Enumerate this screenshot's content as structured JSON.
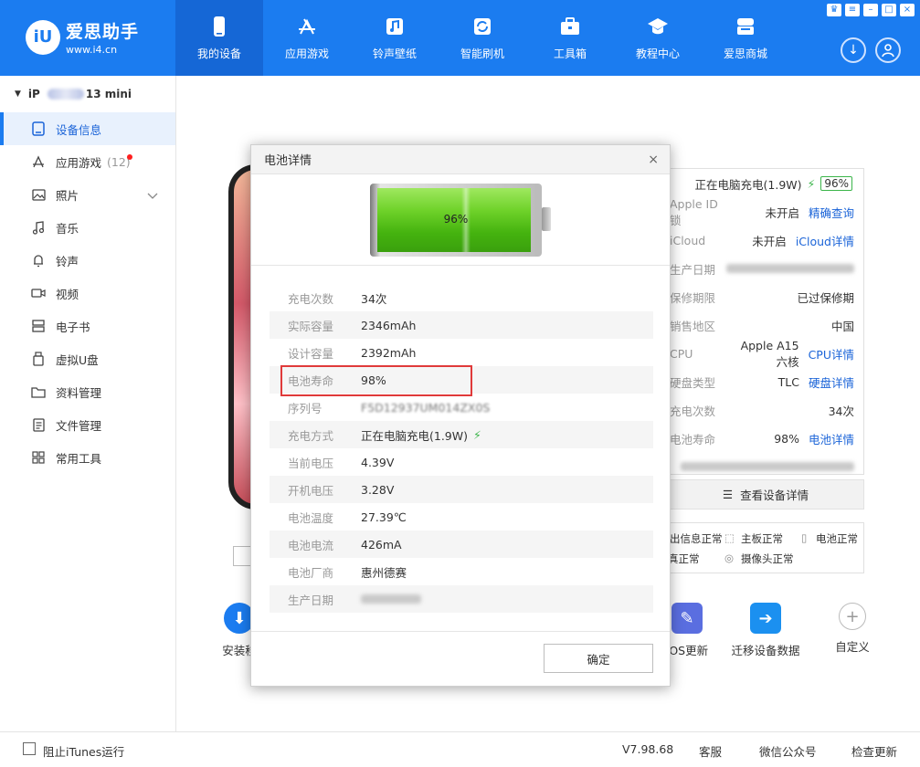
{
  "app": {
    "logo_mark": "iU",
    "title": "爱思助手",
    "url": "www.i4.cn"
  },
  "nav": {
    "items": [
      {
        "label": "我的设备",
        "icon": "phone-icon",
        "active": true
      },
      {
        "label": "应用游戏",
        "icon": "app-store-icon"
      },
      {
        "label": "铃声壁纸",
        "icon": "music-wallpaper-icon"
      },
      {
        "label": "智能刷机",
        "icon": "flash-icon"
      },
      {
        "label": "工具箱",
        "icon": "toolbox-icon"
      },
      {
        "label": "教程中心",
        "icon": "graduation-cap-icon"
      },
      {
        "label": "爱思商城",
        "icon": "store-icon"
      }
    ]
  },
  "sidebar": {
    "device_prefix": "iP",
    "device_suffix": "13 mini",
    "items": [
      {
        "label": "设备信息",
        "icon": "device-info-icon",
        "active": true
      },
      {
        "label": "应用游戏",
        "count": "(12)",
        "icon": "app-icon"
      },
      {
        "label": "照片",
        "icon": "photo-icon"
      },
      {
        "label": "音乐",
        "icon": "music-icon"
      },
      {
        "label": "铃声",
        "icon": "bell-icon"
      },
      {
        "label": "视频",
        "icon": "video-icon"
      },
      {
        "label": "电子书",
        "icon": "ebook-icon"
      },
      {
        "label": "虚拟U盘",
        "icon": "usb-icon"
      },
      {
        "label": "资料管理",
        "icon": "folder-icon"
      },
      {
        "label": "文件管理",
        "icon": "file-icon"
      },
      {
        "label": "常用工具",
        "icon": "tools-grid-icon"
      }
    ]
  },
  "info_panel": {
    "charging_text": "正在电脑充电(1.9W)",
    "battery_percent": "96%",
    "rows": [
      {
        "key": "Apple ID锁",
        "value": "未开启",
        "link": "精确查询"
      },
      {
        "key": "iCloud",
        "value": "未开启",
        "link": "iCloud详情"
      },
      {
        "key": "生产日期",
        "value": "",
        "link": ""
      },
      {
        "key": "保修期限",
        "value": "已过保修期",
        "link": ""
      },
      {
        "key": "销售地区",
        "value": "中国",
        "link": ""
      },
      {
        "key": "CPU",
        "value": "Apple A15 六核",
        "link": "CPU详情"
      },
      {
        "key": "硬盘类型",
        "value": "TLC",
        "link": "硬盘详情"
      },
      {
        "key": "充电次数",
        "value": "34次",
        "link": ""
      },
      {
        "key": "电池寿命",
        "value": "98%",
        "link": "电池详情"
      },
      {
        "key": "",
        "value": "",
        "link": ""
      }
    ],
    "detail_button": "查看设备详情",
    "status": {
      "s1": "出信息正常",
      "s2": "主板正常",
      "s3": "电池正常",
      "s4": "真正常",
      "s5": "摄像头正常"
    }
  },
  "tools": [
    {
      "label": "安装移",
      "color": "#1b7cf0"
    },
    {
      "label": "iOS更新",
      "color": "#5a6ee0"
    },
    {
      "label": "迁移设备数据",
      "color": "#1b90f0"
    },
    {
      "label": "自定义",
      "color": "#ffffff"
    }
  ],
  "dialog": {
    "title": "电池详情",
    "close": "×",
    "battery_level_text": "96%",
    "battery_level": 0.96,
    "rows": [
      {
        "key": "充电次数",
        "value": "34次"
      },
      {
        "key": "实际容量",
        "value": "2346mAh"
      },
      {
        "key": "设计容量",
        "value": "2392mAh"
      },
      {
        "key": "电池寿命",
        "value": "98%"
      },
      {
        "key": "序列号",
        "value": "F5D12937UM014ZX0S"
      },
      {
        "key": "充电方式",
        "value": "正在电脑充电(1.9W)"
      },
      {
        "key": "当前电压",
        "value": "4.39V"
      },
      {
        "key": "开机电压",
        "value": "3.28V"
      },
      {
        "key": "电池温度",
        "value": "27.39℃"
      },
      {
        "key": "电池电流",
        "value": "426mA"
      },
      {
        "key": "电池厂商",
        "value": "惠州德赛"
      },
      {
        "key": "生产日期",
        "value": ""
      }
    ],
    "ok_label": "确定"
  },
  "footer": {
    "block_itunes": "阻止iTunes运行",
    "version": "V7.98.68",
    "service": "客服",
    "wechat": "微信公众号",
    "update": "检查更新"
  },
  "colors": {
    "brand": "#1b7cf0",
    "highlight_border": "#e03a3a",
    "battery_green": "#45b30f"
  }
}
